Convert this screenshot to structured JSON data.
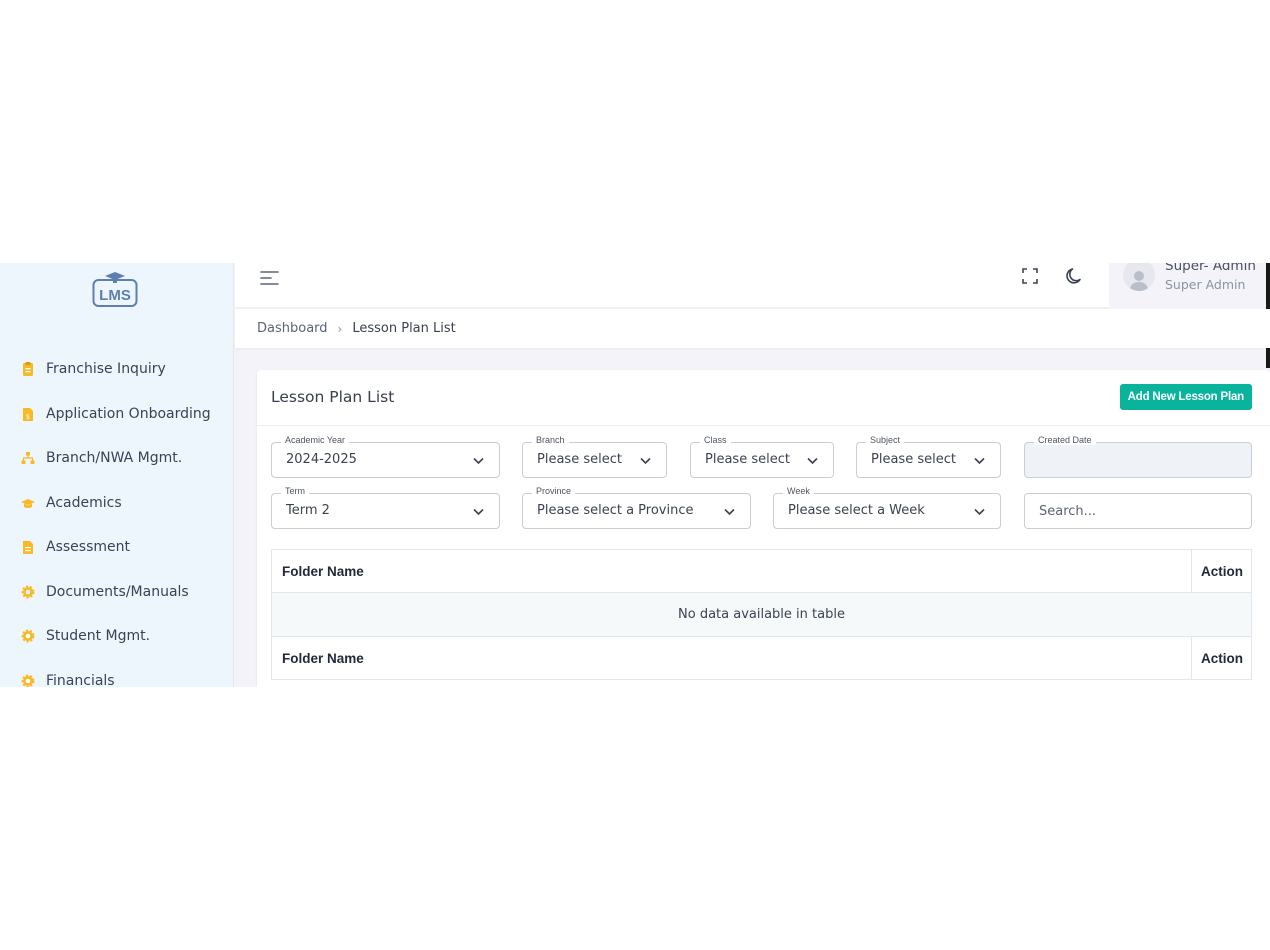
{
  "sidebar": {
    "logo_text": "LMS",
    "items": [
      {
        "label": "Franchise Inquiry",
        "icon": "clipboard-icon"
      },
      {
        "label": "Application Onboarding",
        "icon": "document-dollar-icon"
      },
      {
        "label": "Branch/NWA Mgmt.",
        "icon": "sitemap-icon"
      },
      {
        "label": "Academics",
        "icon": "graduation-cap-icon"
      },
      {
        "label": "Assessment",
        "icon": "document-icon"
      },
      {
        "label": "Documents/Manuals",
        "icon": "gear-icon"
      },
      {
        "label": "Student Mgmt.",
        "icon": "gear-icon"
      },
      {
        "label": "Financials",
        "icon": "gear-icon"
      }
    ],
    "icon_color": "#f7b924"
  },
  "topbar": {
    "user_name": "Super- Admin",
    "user_role": "Super Admin"
  },
  "breadcrumb": {
    "home": "Dashboard",
    "current": "Lesson Plan List"
  },
  "card": {
    "title": "Lesson Plan List",
    "add_button_label": "Add New Lesson Plan",
    "accent_color": "#0ab39c"
  },
  "filters": {
    "academic_year": {
      "label": "Academic Year",
      "value": "2024-2025"
    },
    "branch": {
      "label": "Branch",
      "value": "Please select"
    },
    "class": {
      "label": "Class",
      "value": "Please select"
    },
    "subject": {
      "label": "Subject",
      "value": "Please select"
    },
    "created_date": {
      "label": "Created Date",
      "value": ""
    },
    "term": {
      "label": "Term",
      "value": "Term 2"
    },
    "province": {
      "label": "Province",
      "value": "Please select a Province"
    },
    "week": {
      "label": "Week",
      "value": "Please select a Week"
    },
    "search": {
      "placeholder": "Search..."
    }
  },
  "table": {
    "columns": [
      "Folder Name",
      "Action"
    ],
    "empty_message": "No data available in table",
    "footer_columns": [
      "Folder Name",
      "Action"
    ]
  }
}
